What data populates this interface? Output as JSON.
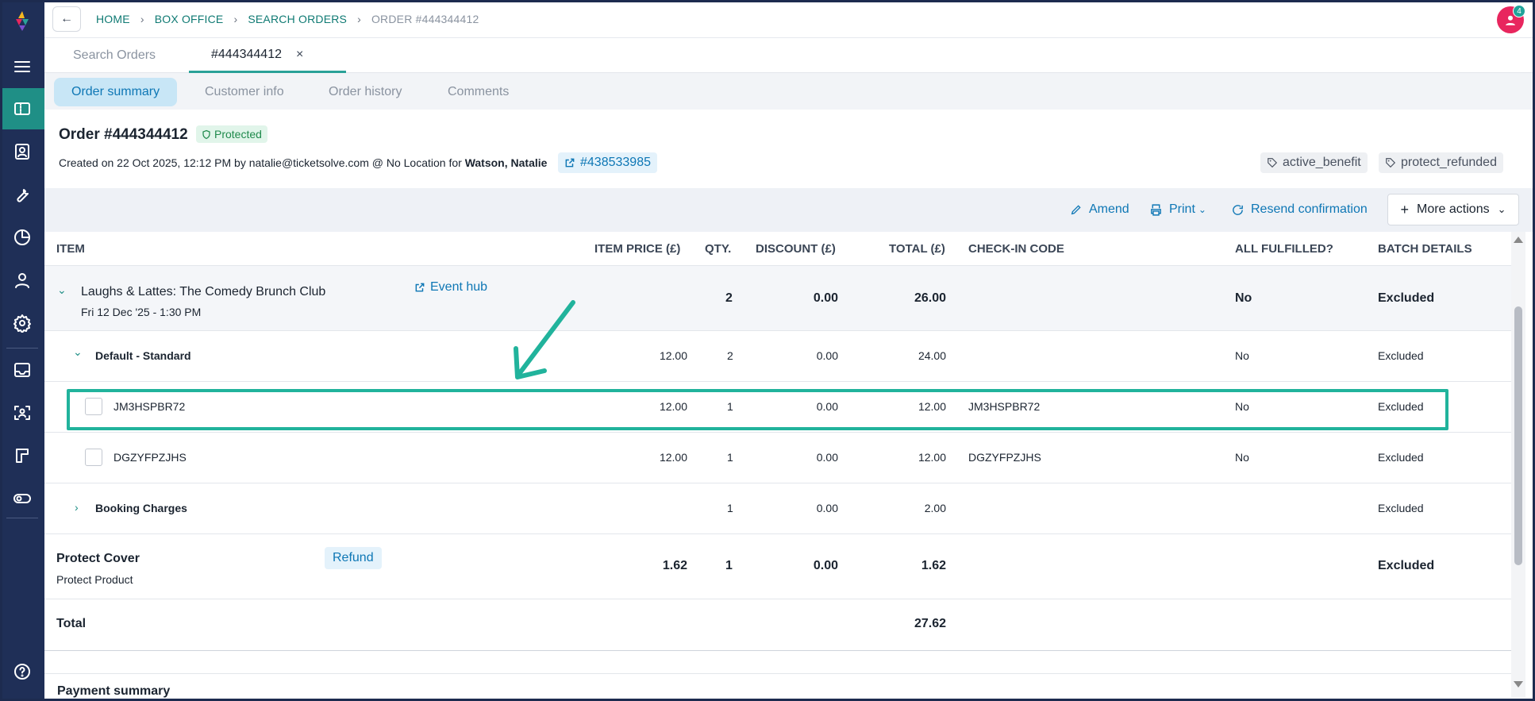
{
  "breadcrumb": {
    "items": [
      "HOME",
      "BOX OFFICE",
      "SEARCH ORDERS",
      "ORDER #444344412"
    ]
  },
  "user": {
    "notification_count": "4"
  },
  "page_tabs": {
    "search_orders": "Search Orders",
    "order_tab": "#444344412",
    "close_symbol": "×"
  },
  "sub_tabs": {
    "order_summary": "Order summary",
    "customer_info": "Customer info",
    "order_history": "Order history",
    "comments": "Comments"
  },
  "order": {
    "title": "Order #444344412",
    "status_badge": "Protected",
    "created_prefix": "Created on 22 Oct 2025, 12:12 PM by natalie@ticketsolve.com @ No Location for ",
    "customer_name": "Watson, Natalie",
    "linked_order": "#438533985",
    "tags": [
      "active_benefit",
      "protect_refunded"
    ]
  },
  "actions": {
    "amend": "Amend",
    "print": "Print",
    "resend": "Resend confirmation",
    "more": "More actions"
  },
  "table": {
    "headers": {
      "item": "ITEM",
      "item_price": "ITEM PRICE (£)",
      "qty": "QTY.",
      "discount": "DISCOUNT (£)",
      "total": "TOTAL (£)",
      "checkin": "CHECK-IN CODE",
      "fulfilled": "ALL FULFILLED?",
      "batch": "BATCH DETAILS"
    },
    "event": {
      "name": "Laughs & Lattes: The Comedy Brunch Club",
      "date": "Fri 12 Dec '25 - 1:30 PM",
      "hub_link": "Event hub",
      "qty": "2",
      "discount": "0.00",
      "total": "26.00",
      "fulfilled": "No",
      "batch": "Excluded"
    },
    "price_group": {
      "name": "Default - Standard",
      "price": "12.00",
      "qty": "2",
      "discount": "0.00",
      "total": "24.00",
      "fulfilled": "No",
      "batch": "Excluded"
    },
    "tickets": [
      {
        "code": "JM3HSPBR72",
        "price": "12.00",
        "qty": "1",
        "discount": "0.00",
        "total": "12.00",
        "checkin": "JM3HSPBR72",
        "fulfilled": "No",
        "batch": "Excluded"
      },
      {
        "code": "DGZYFPZJHS",
        "price": "12.00",
        "qty": "1",
        "discount": "0.00",
        "total": "12.00",
        "checkin": "DGZYFPZJHS",
        "fulfilled": "No",
        "batch": "Excluded"
      }
    ],
    "booking_charges": {
      "name": "Booking Charges",
      "qty": "1",
      "discount": "0.00",
      "total": "2.00",
      "batch": "Excluded"
    },
    "protect": {
      "name": "Protect Cover",
      "sub": "Protect Product",
      "refund_label": "Refund",
      "price": "1.62",
      "qty": "1",
      "discount": "0.00",
      "total": "1.62",
      "batch": "Excluded"
    },
    "grand_total": {
      "label": "Total",
      "value": "27.62"
    }
  },
  "payment_summary": "Payment summary",
  "colors": {
    "sidebar": "#1f2f57",
    "accent_teal": "#1f8f86",
    "link_blue": "#0e77b5",
    "highlight": "#21b39c"
  }
}
